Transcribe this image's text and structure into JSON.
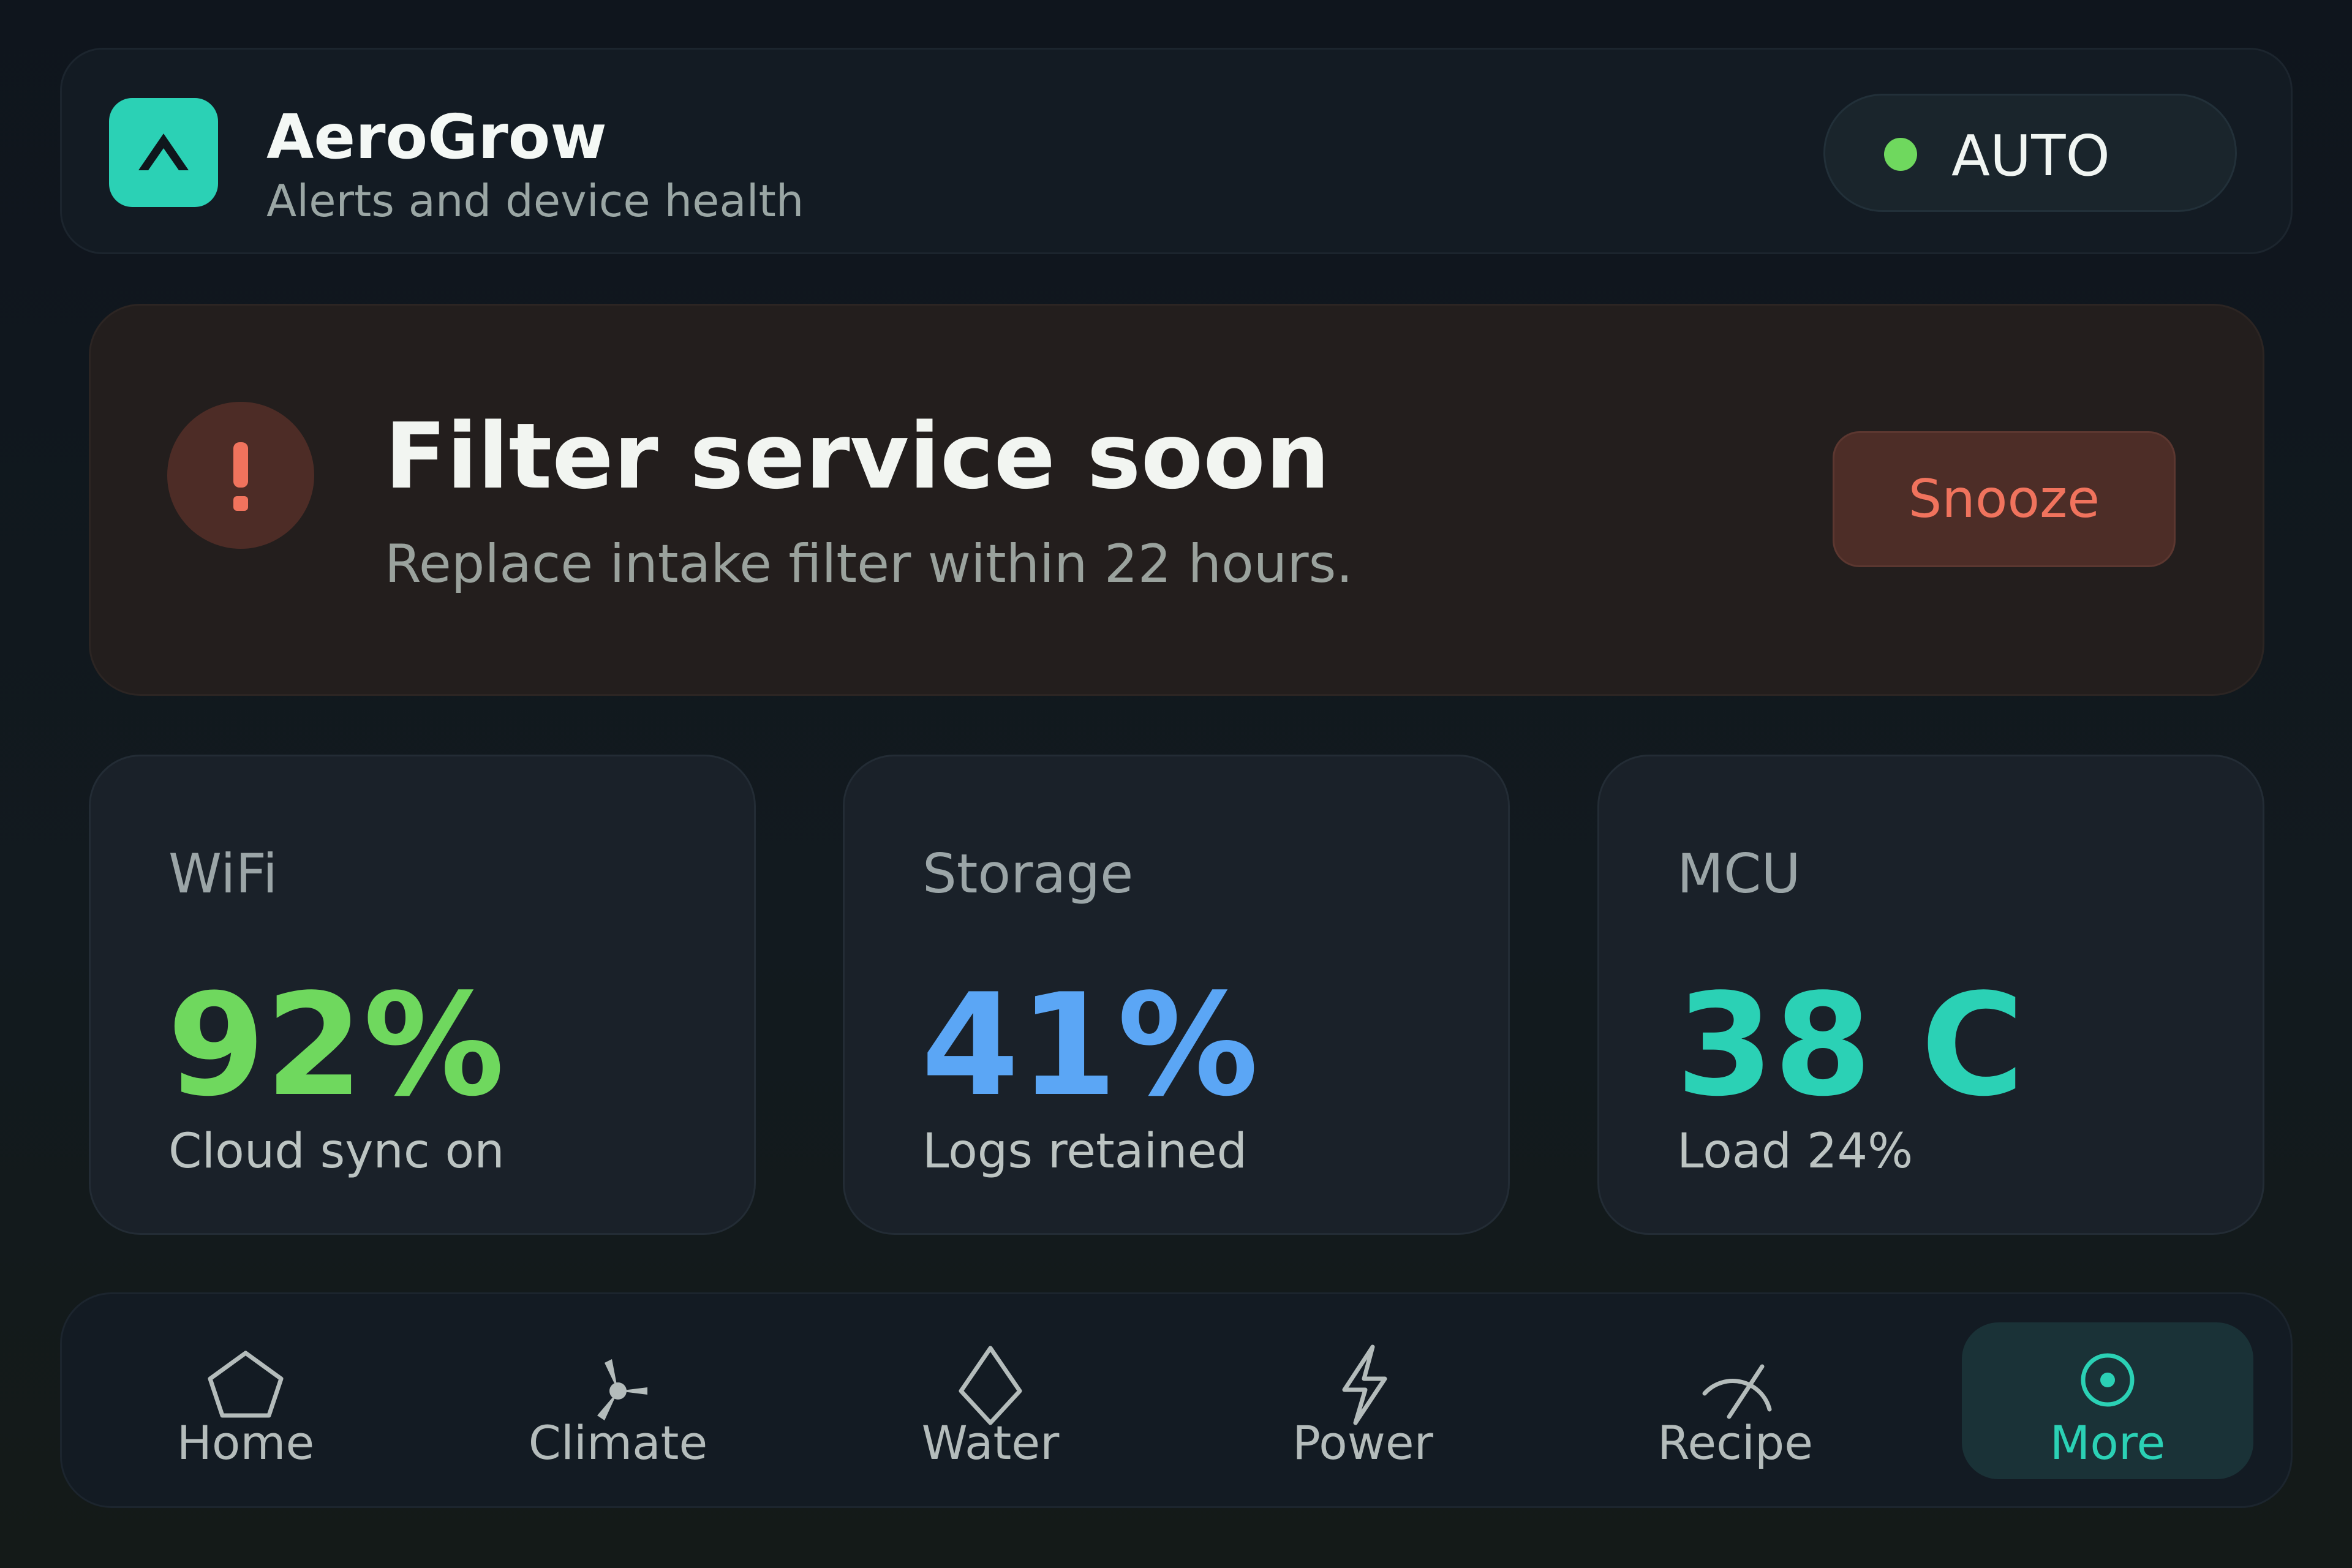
{
  "app": {
    "title": "AeroGrow",
    "subtitle": "Alerts and device health",
    "logo_icon": "caret-up-logo",
    "mode": {
      "label": "AUTO",
      "status_color": "#6fd85e"
    }
  },
  "alert": {
    "icon": "exclamation-icon",
    "title": "Filter service soon",
    "message": "Replace intake filter within 22 hours.",
    "action_label": "Snooze",
    "accent_color": "#f0735d"
  },
  "stats": [
    {
      "label": "WiFi",
      "value": "92%",
      "sub": "Cloud sync on",
      "color": "#6fd85e"
    },
    {
      "label": "Storage",
      "value": "41%",
      "sub": "Logs retained",
      "color": "#5ba6f5"
    },
    {
      "label": "MCU",
      "value": "38 C",
      "sub": "Load 24%",
      "color": "#2bd1b5"
    }
  ],
  "nav": {
    "items": [
      {
        "label": "Home",
        "icon": "home-icon"
      },
      {
        "label": "Climate",
        "icon": "fan-icon"
      },
      {
        "label": "Water",
        "icon": "droplet-icon"
      },
      {
        "label": "Power",
        "icon": "bolt-icon"
      },
      {
        "label": "Recipe",
        "icon": "gauge-icon"
      },
      {
        "label": "More",
        "icon": "more-circle-icon",
        "active": true
      }
    ],
    "active_color": "#2bd1b5"
  }
}
